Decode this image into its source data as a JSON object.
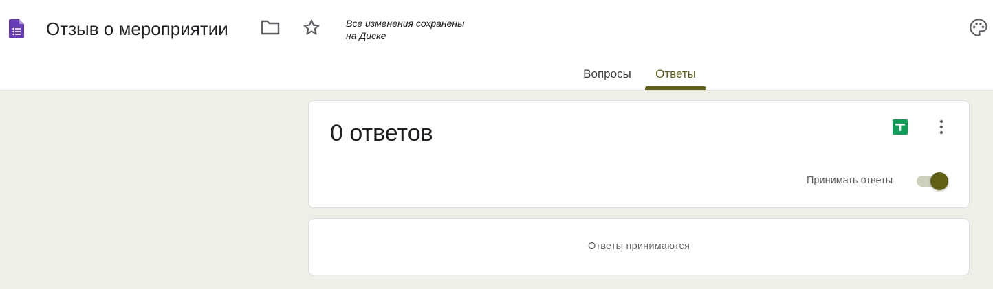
{
  "app": {
    "logo_icon": "google-forms-icon",
    "brand_color": "#673ab7"
  },
  "header": {
    "title": "Отзыв о мероприятии",
    "folder_icon": "folder-icon",
    "star_icon": "star-icon",
    "palette_icon": "palette-icon",
    "save_status_line1": "Все изменения сохранены",
    "save_status_line2": "на Диске"
  },
  "tabs": {
    "items": [
      {
        "label": "Вопросы",
        "active": false
      },
      {
        "label": "Ответы",
        "active": true
      }
    ],
    "accent_color": "#5f6014"
  },
  "summary": {
    "count_label": "0 ответов",
    "sheets_icon": "google-sheets-icon",
    "sheets_color": "#0f9d58",
    "more_icon": "more-vert-icon",
    "accept_label": "Принимать ответы",
    "accepting": true
  },
  "status": {
    "text": "Ответы принимаются"
  }
}
